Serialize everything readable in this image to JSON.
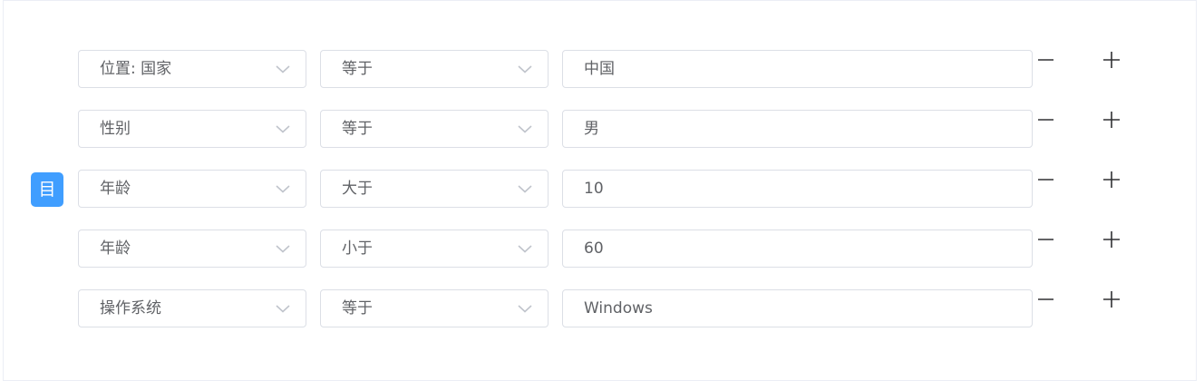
{
  "logic_toggle": {
    "label": "目",
    "icon": "list-icon",
    "color": "#409eff"
  },
  "rows": [
    {
      "field": "位置: 国家",
      "operator": "等于",
      "value": "中国"
    },
    {
      "field": "性别",
      "operator": "等于",
      "value": "男"
    },
    {
      "field": "年龄",
      "operator": "大于",
      "value": "10"
    },
    {
      "field": "年龄",
      "operator": "小于",
      "value": "60"
    },
    {
      "field": "操作系统",
      "operator": "等于",
      "value": "Windows"
    }
  ],
  "icons": {
    "dropdown": "chevron-down-icon",
    "remove": "minus-icon",
    "add": "plus-icon"
  }
}
